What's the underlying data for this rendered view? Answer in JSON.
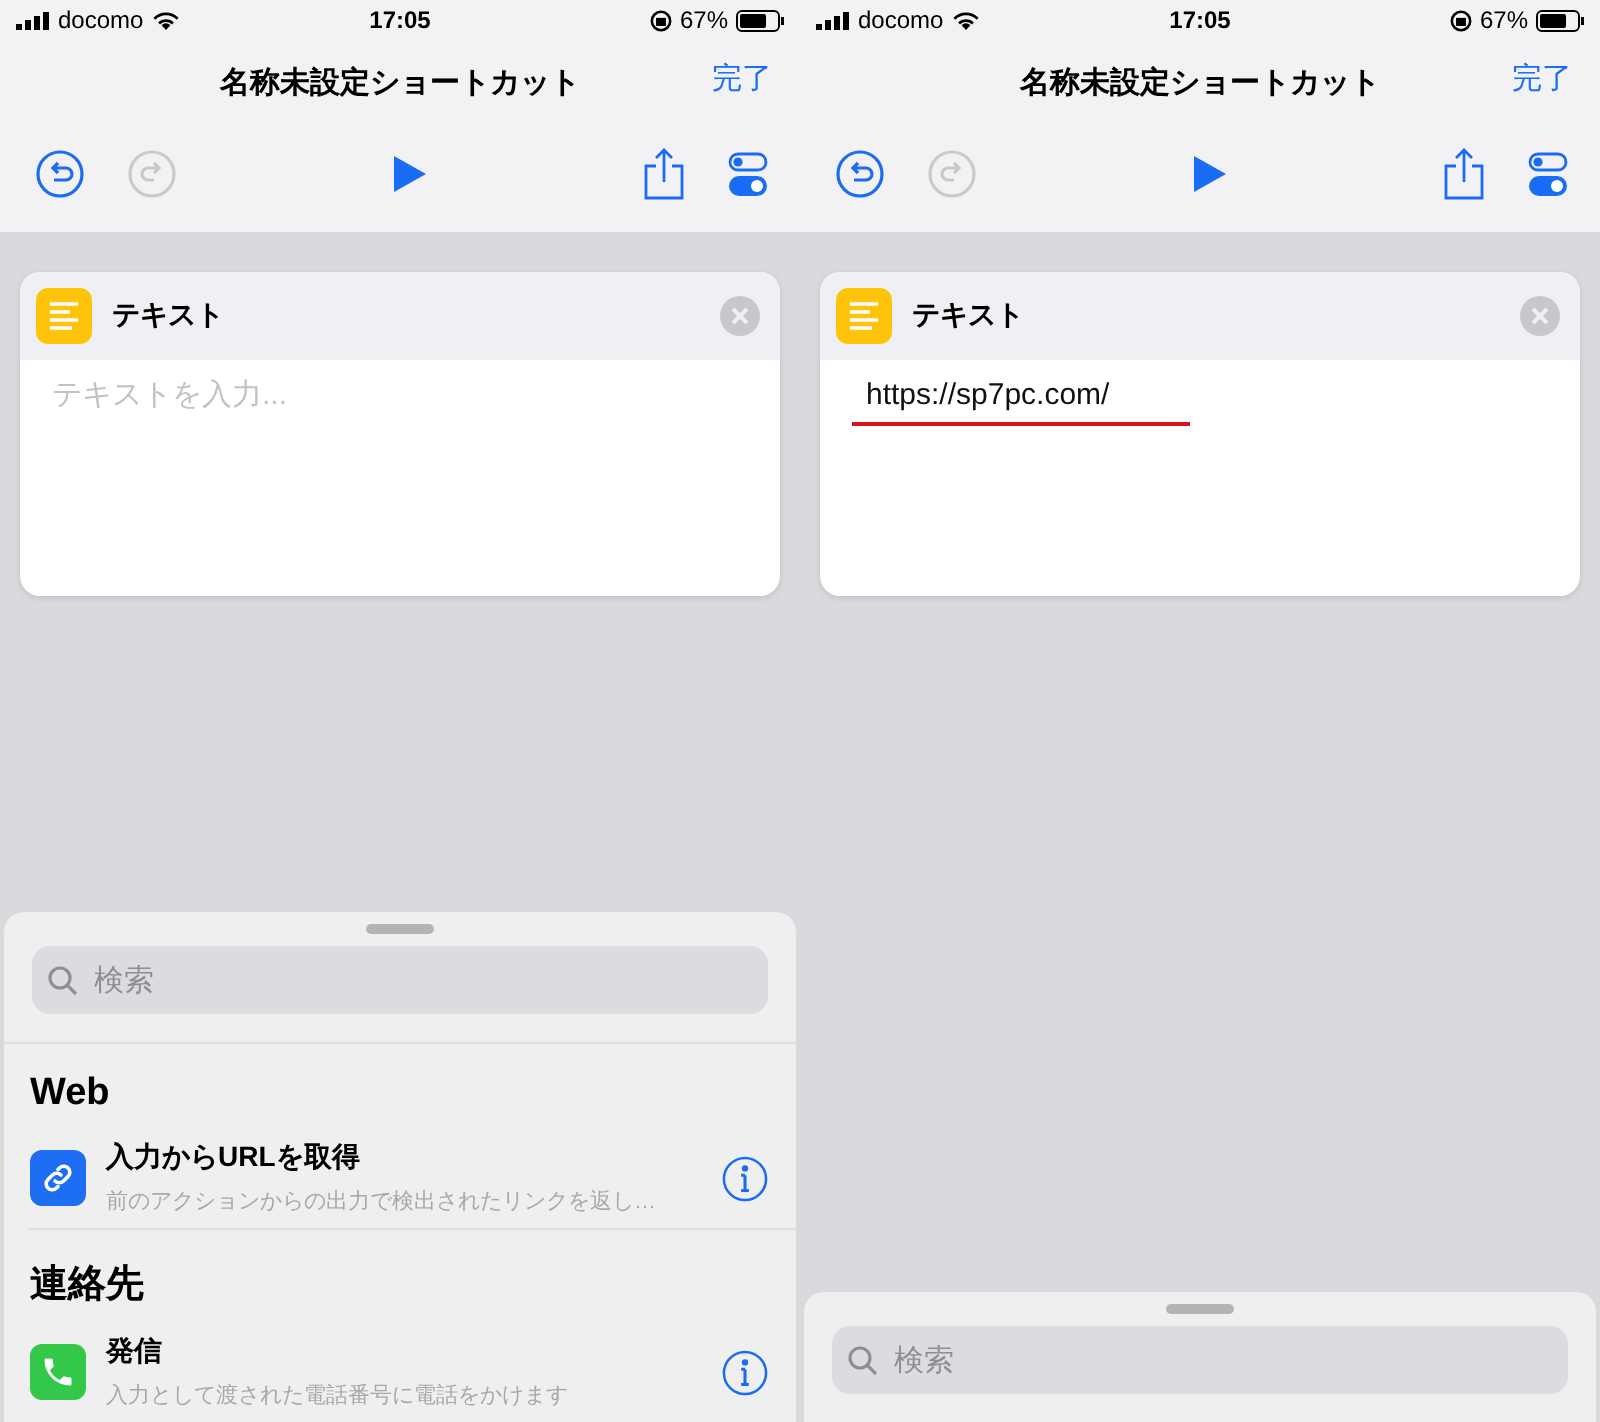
{
  "screens": [
    {
      "status_bar": {
        "carrier": "docomo",
        "time": "17:05",
        "battery": "67%"
      },
      "nav": {
        "title": "名称未設定ショートカット",
        "done": "完了"
      },
      "action_card": {
        "title": "テキスト",
        "placeholder": "テキストを入力...",
        "underlined": false
      },
      "sheet": {
        "search_placeholder": "検索",
        "sections": [
          {
            "title": "Web",
            "actions": [
              {
                "kind": "link",
                "title": "入力からURLを取得",
                "subtitle": "前のアクションからの出力で検出されたリンクを返し…"
              }
            ]
          },
          {
            "title": "連絡先",
            "actions": [
              {
                "kind": "phone",
                "title": "発信",
                "subtitle": "入力として渡された電話番号に電話をかけます"
              }
            ]
          }
        ]
      }
    },
    {
      "status_bar": {
        "carrier": "docomo",
        "time": "17:05",
        "battery": "67%"
      },
      "nav": {
        "title": "名称未設定ショートカット",
        "done": "完了"
      },
      "action_card": {
        "title": "テキスト",
        "value": "https://sp7pc.com/",
        "underlined": true
      },
      "sheet": {
        "search_placeholder": "検索"
      }
    }
  ]
}
